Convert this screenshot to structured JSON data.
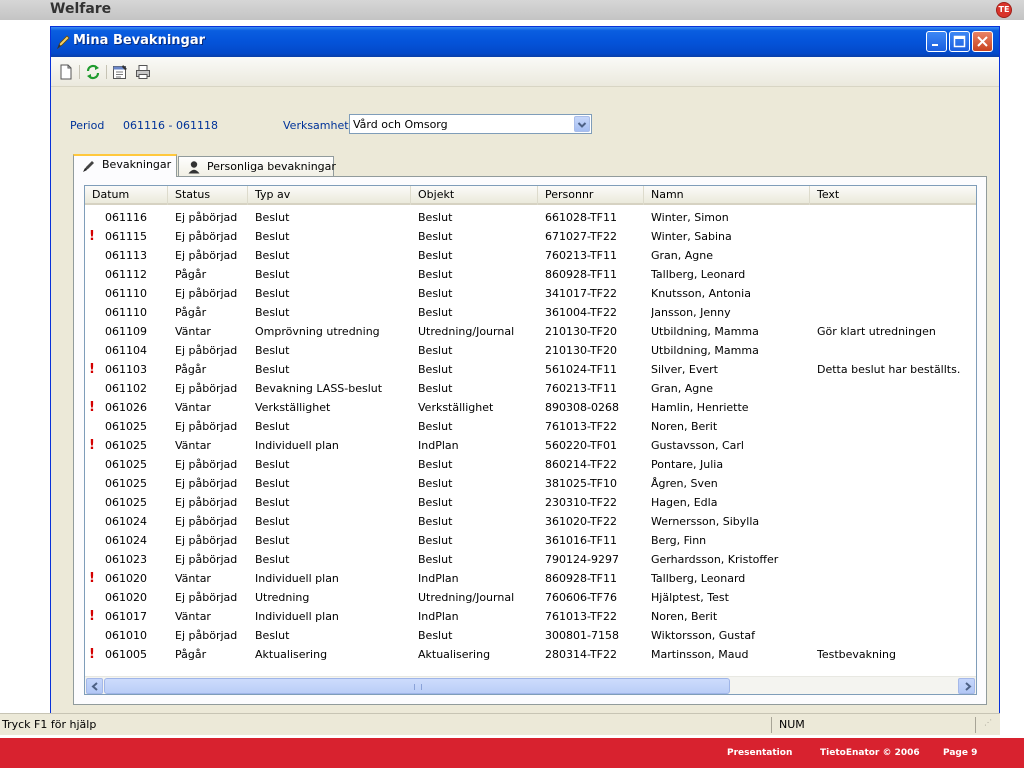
{
  "slide": {
    "title": "Welfare",
    "logo": "TE"
  },
  "window": {
    "title": "Mina Bevakningar"
  },
  "toolbar": {
    "icons": [
      "new-document-icon",
      "refresh-icon",
      "properties-icon",
      "print-icon"
    ]
  },
  "filter": {
    "period_label": "Period",
    "period_value": "061116 - 061118",
    "verksamhet_label": "Verksamhet",
    "verksamhet_value": "Vård och Omsorg"
  },
  "tabs": [
    {
      "label": "Bevakningar",
      "active": true
    },
    {
      "label": "Personliga bevakningar",
      "active": false
    }
  ],
  "table": {
    "columns": [
      "Datum",
      "Status",
      "Typ av",
      "Objekt",
      "Personnr",
      "Namn",
      "Text"
    ],
    "rows": [
      {
        "flag": false,
        "datum": "061116",
        "status": "Ej påbörjad",
        "typ": "Beslut",
        "objekt": "Beslut",
        "personnr": "661028-TF11",
        "namn": "Winter, Simon",
        "text": ""
      },
      {
        "flag": true,
        "datum": "061115",
        "status": "Ej påbörjad",
        "typ": "Beslut",
        "objekt": "Beslut",
        "personnr": "671027-TF22",
        "namn": "Winter, Sabina",
        "text": ""
      },
      {
        "flag": false,
        "datum": "061113",
        "status": "Ej påbörjad",
        "typ": "Beslut",
        "objekt": "Beslut",
        "personnr": "760213-TF11",
        "namn": "Gran, Agne",
        "text": ""
      },
      {
        "flag": false,
        "datum": "061112",
        "status": "Pågår",
        "typ": "Beslut",
        "objekt": "Beslut",
        "personnr": "860928-TF11",
        "namn": "Tallberg, Leonard",
        "text": ""
      },
      {
        "flag": false,
        "datum": "061110",
        "status": "Ej påbörjad",
        "typ": "Beslut",
        "objekt": "Beslut",
        "personnr": "341017-TF22",
        "namn": "Knutsson, Antonia",
        "text": ""
      },
      {
        "flag": false,
        "datum": "061110",
        "status": "Pågår",
        "typ": "Beslut",
        "objekt": "Beslut",
        "personnr": "361004-TF22",
        "namn": "Jansson, Jenny",
        "text": ""
      },
      {
        "flag": false,
        "datum": "061109",
        "status": "Väntar",
        "typ": "Omprövning utredning",
        "objekt": "Utredning/Journal",
        "personnr": "210130-TF20",
        "namn": "Utbildning, Mamma",
        "text": "Gör klart utredningen"
      },
      {
        "flag": false,
        "datum": "061104",
        "status": "Ej påbörjad",
        "typ": "Beslut",
        "objekt": "Beslut",
        "personnr": "210130-TF20",
        "namn": "Utbildning, Mamma",
        "text": ""
      },
      {
        "flag": true,
        "datum": "061103",
        "status": "Pågår",
        "typ": "Beslut",
        "objekt": "Beslut",
        "personnr": "561024-TF11",
        "namn": "Silver, Evert",
        "text": "Detta beslut har beställts."
      },
      {
        "flag": false,
        "datum": "061102",
        "status": "Ej påbörjad",
        "typ": "Bevakning LASS-beslut",
        "objekt": "Beslut",
        "personnr": "760213-TF11",
        "namn": "Gran, Agne",
        "text": ""
      },
      {
        "flag": true,
        "datum": "061026",
        "status": "Väntar",
        "typ": "Verkställighet",
        "objekt": "Verkställighet",
        "personnr": "890308-0268",
        "namn": "Hamlin, Henriette",
        "text": ""
      },
      {
        "flag": false,
        "datum": "061025",
        "status": "Ej påbörjad",
        "typ": "Beslut",
        "objekt": "Beslut",
        "personnr": "761013-TF22",
        "namn": "Noren, Berit",
        "text": ""
      },
      {
        "flag": true,
        "datum": "061025",
        "status": "Väntar",
        "typ": "Individuell plan",
        "objekt": "IndPlan",
        "personnr": "560220-TF01",
        "namn": "Gustavsson, Carl",
        "text": ""
      },
      {
        "flag": false,
        "datum": "061025",
        "status": "Ej påbörjad",
        "typ": "Beslut",
        "objekt": "Beslut",
        "personnr": "860214-TF22",
        "namn": "Pontare, Julia",
        "text": ""
      },
      {
        "flag": false,
        "datum": "061025",
        "status": "Ej påbörjad",
        "typ": "Beslut",
        "objekt": "Beslut",
        "personnr": "381025-TF10",
        "namn": "Ågren, Sven",
        "text": ""
      },
      {
        "flag": false,
        "datum": "061025",
        "status": "Ej påbörjad",
        "typ": "Beslut",
        "objekt": "Beslut",
        "personnr": "230310-TF22",
        "namn": "Hagen, Edla",
        "text": ""
      },
      {
        "flag": false,
        "datum": "061024",
        "status": "Ej påbörjad",
        "typ": "Beslut",
        "objekt": "Beslut",
        "personnr": "361020-TF22",
        "namn": "Wernersson, Sibylla",
        "text": ""
      },
      {
        "flag": false,
        "datum": "061024",
        "status": "Ej påbörjad",
        "typ": "Beslut",
        "objekt": "Beslut",
        "personnr": "361016-TF11",
        "namn": "Berg, Finn",
        "text": ""
      },
      {
        "flag": false,
        "datum": "061023",
        "status": "Ej påbörjad",
        "typ": "Beslut",
        "objekt": "Beslut",
        "personnr": "790124-9297",
        "namn": "Gerhardsson, Kristoffer",
        "text": ""
      },
      {
        "flag": true,
        "datum": "061020",
        "status": "Väntar",
        "typ": "Individuell plan",
        "objekt": "IndPlan",
        "personnr": "860928-TF11",
        "namn": "Tallberg, Leonard",
        "text": ""
      },
      {
        "flag": false,
        "datum": "061020",
        "status": "Ej påbörjad",
        "typ": "Utredning",
        "objekt": "Utredning/Journal",
        "personnr": "760606-TF76",
        "namn": "Hjälptest, Test",
        "text": ""
      },
      {
        "flag": true,
        "datum": "061017",
        "status": "Väntar",
        "typ": "Individuell plan",
        "objekt": "IndPlan",
        "personnr": "761013-TF22",
        "namn": "Noren, Berit",
        "text": ""
      },
      {
        "flag": false,
        "datum": "061010",
        "status": "Ej påbörjad",
        "typ": "Beslut",
        "objekt": "Beslut",
        "personnr": "300801-7158",
        "namn": "Wiktorsson, Gustaf",
        "text": ""
      },
      {
        "flag": true,
        "datum": "061005",
        "status": "Pågår",
        "typ": "Aktualisering",
        "objekt": "Aktualisering",
        "personnr": "280314-TF22",
        "namn": "Martinsson, Maud",
        "text": "Testbevakning"
      }
    ]
  },
  "statusbar": {
    "help": "Tryck F1 för hjälp",
    "num": "NUM"
  },
  "footer": {
    "presentation": "Presentation",
    "copyright": "TietoEnator © 2006",
    "page": "Page 9"
  },
  "colors": {
    "footer": "#d8222f",
    "titlebar": "#0453d9",
    "label": "#003399",
    "flag": "#d40000"
  }
}
